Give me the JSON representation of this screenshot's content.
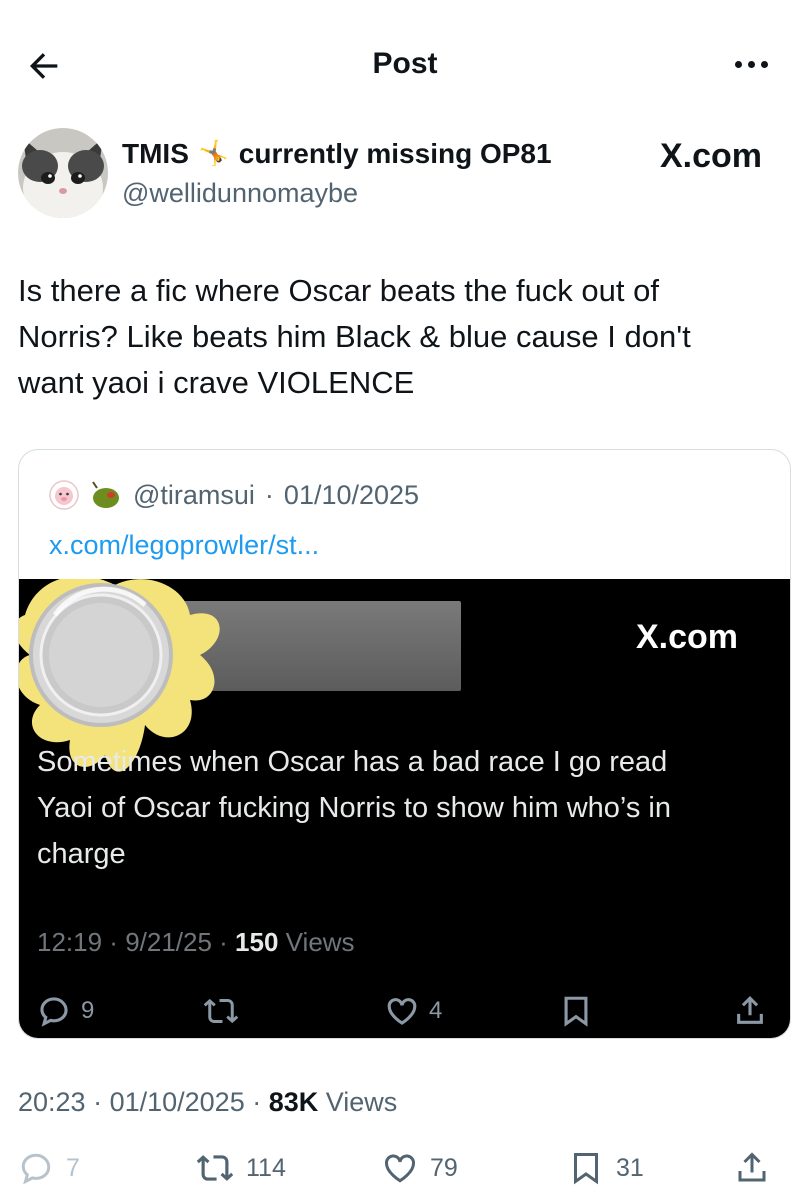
{
  "header": {
    "title": "Post",
    "back_icon": "arrow-left-icon",
    "more_icon": "more-horizontal-icon"
  },
  "author": {
    "name_part1": "TMIS",
    "name_emoji": "🤸",
    "name_part2": "currently missing OP81",
    "handle": "@wellidunnomaybe"
  },
  "watermark": "X.com",
  "tweet": {
    "lines": [
      "Is there a fic where Oscar beats the fuck out of",
      "Norris? Like beats him Black & blue cause I don't",
      "want yaoi i crave VIOLENCE"
    ]
  },
  "quote": {
    "handle": "@tiramsui",
    "separator": "·",
    "date": "01/10/2025",
    "link": "x.com/legoprowler/st...",
    "inner": {
      "watermark": "X.com",
      "text_lines": [
        "Sometimes when Oscar has a bad race I go read",
        "Yaoi of Oscar fucking Norris to show him who’s in",
        "charge"
      ],
      "time": "12:19",
      "date": "9/21/25",
      "views_count": "150",
      "views_label": "Views",
      "replies": "9",
      "likes": "4"
    }
  },
  "post_meta": {
    "time": "20:23",
    "date": "01/10/2025",
    "views_count": "83K",
    "views_label": "Views"
  },
  "actions": {
    "replies": "7",
    "retweets": "114",
    "likes": "79",
    "bookmarks": "31"
  },
  "colors": {
    "text": "#0f1419",
    "secondary": "#536471",
    "link": "#1d9bf0",
    "border": "#d6dde3"
  }
}
